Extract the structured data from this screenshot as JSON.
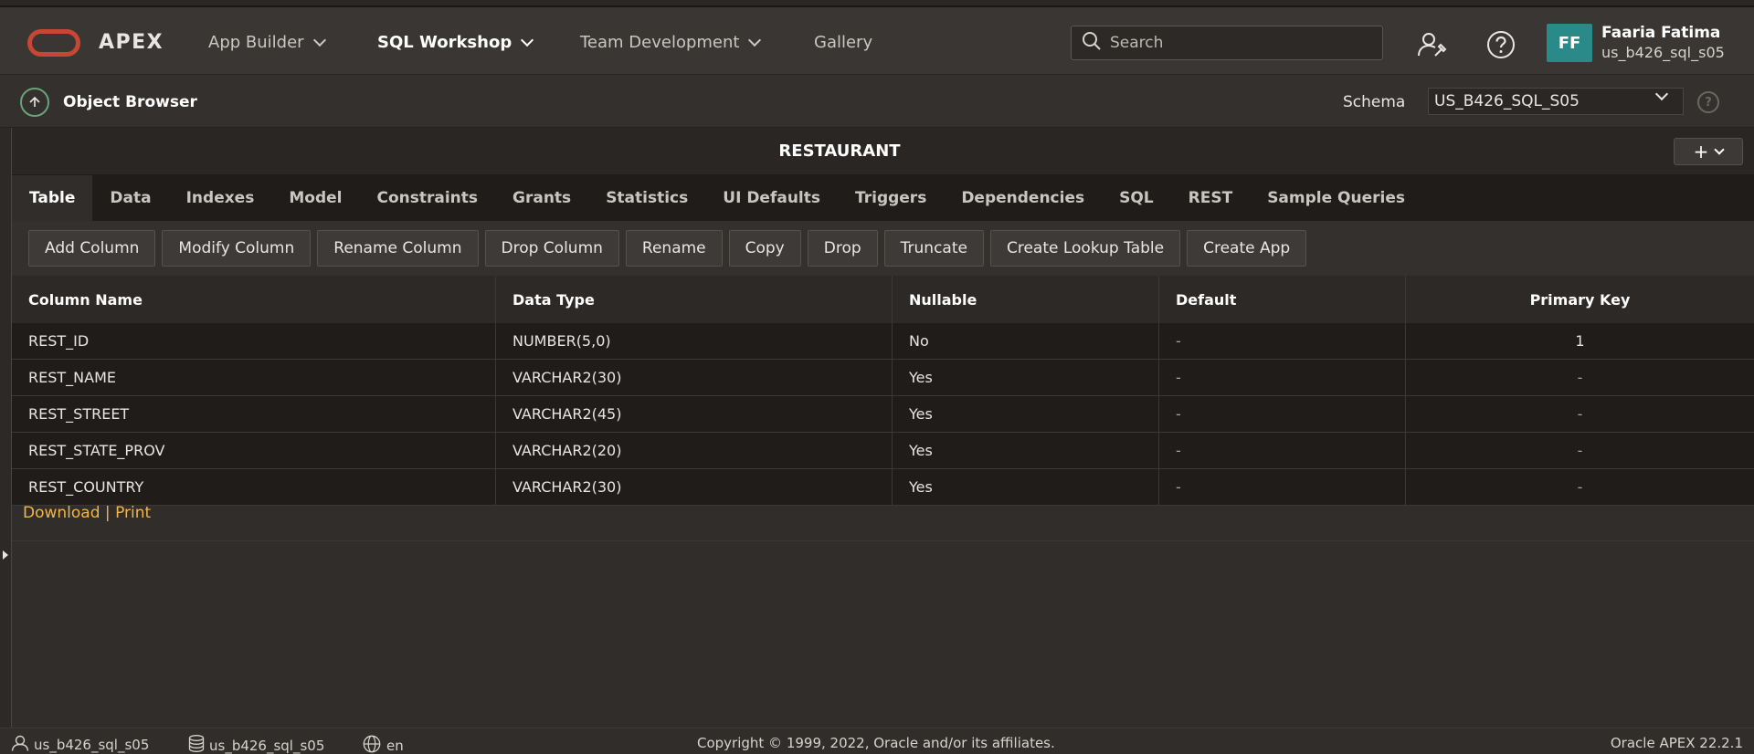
{
  "header": {
    "app_name": "APEX",
    "nav": [
      {
        "label": "App Builder"
      },
      {
        "label": "SQL Workshop"
      },
      {
        "label": "Team Development"
      },
      {
        "label": "Gallery"
      }
    ],
    "search_placeholder": "Search",
    "user": {
      "initials": "FF",
      "name": "Faaria Fatima",
      "id": "us_b426_sql_s05"
    },
    "icons": [
      "logo-ring",
      "search-icon",
      "admin-user-wrench-icon",
      "help-icon",
      "chevron-down-icon"
    ]
  },
  "subbar": {
    "title": "Object Browser",
    "schema_label": "Schema",
    "schema_value": "US_B426_SQL_S05"
  },
  "object": {
    "title": "RESTAURANT",
    "tabs": [
      {
        "label": "Table"
      },
      {
        "label": "Data"
      },
      {
        "label": "Indexes"
      },
      {
        "label": "Model"
      },
      {
        "label": "Constraints"
      },
      {
        "label": "Grants"
      },
      {
        "label": "Statistics"
      },
      {
        "label": "UI Defaults"
      },
      {
        "label": "Triggers"
      },
      {
        "label": "Dependencies"
      },
      {
        "label": "SQL"
      },
      {
        "label": "REST"
      },
      {
        "label": "Sample Queries"
      }
    ],
    "buttons": [
      {
        "label": "Add Column"
      },
      {
        "label": "Modify Column"
      },
      {
        "label": "Rename Column"
      },
      {
        "label": "Drop Column"
      },
      {
        "label": "Rename"
      },
      {
        "label": "Copy"
      },
      {
        "label": "Drop"
      },
      {
        "label": "Truncate"
      },
      {
        "label": "Create Lookup Table"
      },
      {
        "label": "Create App"
      }
    ],
    "columns_header": [
      "Column Name",
      "Data Type",
      "Nullable",
      "Default",
      "Primary Key"
    ],
    "rows": [
      [
        "REST_ID",
        "NUMBER(5,0)",
        "No",
        "-",
        "1"
      ],
      [
        "REST_NAME",
        "VARCHAR2(30)",
        "Yes",
        "-",
        "-"
      ],
      [
        "REST_STREET",
        "VARCHAR2(45)",
        "Yes",
        "-",
        "-"
      ],
      [
        "REST_STATE_PROV",
        "VARCHAR2(20)",
        "Yes",
        "-",
        "-"
      ],
      [
        "REST_COUNTRY",
        "VARCHAR2(30)",
        "Yes",
        "-",
        "-"
      ]
    ],
    "download_label": "Download",
    "separator": "|",
    "print_label": "Print"
  },
  "footer": {
    "user": "us_b426_sql_s05",
    "schema": "us_b426_sql_s05",
    "language": "en",
    "copyright": "Copyright © 1999, 2022, Oracle and/or its affiliates.",
    "version": "Oracle APEX 22.2.1"
  }
}
